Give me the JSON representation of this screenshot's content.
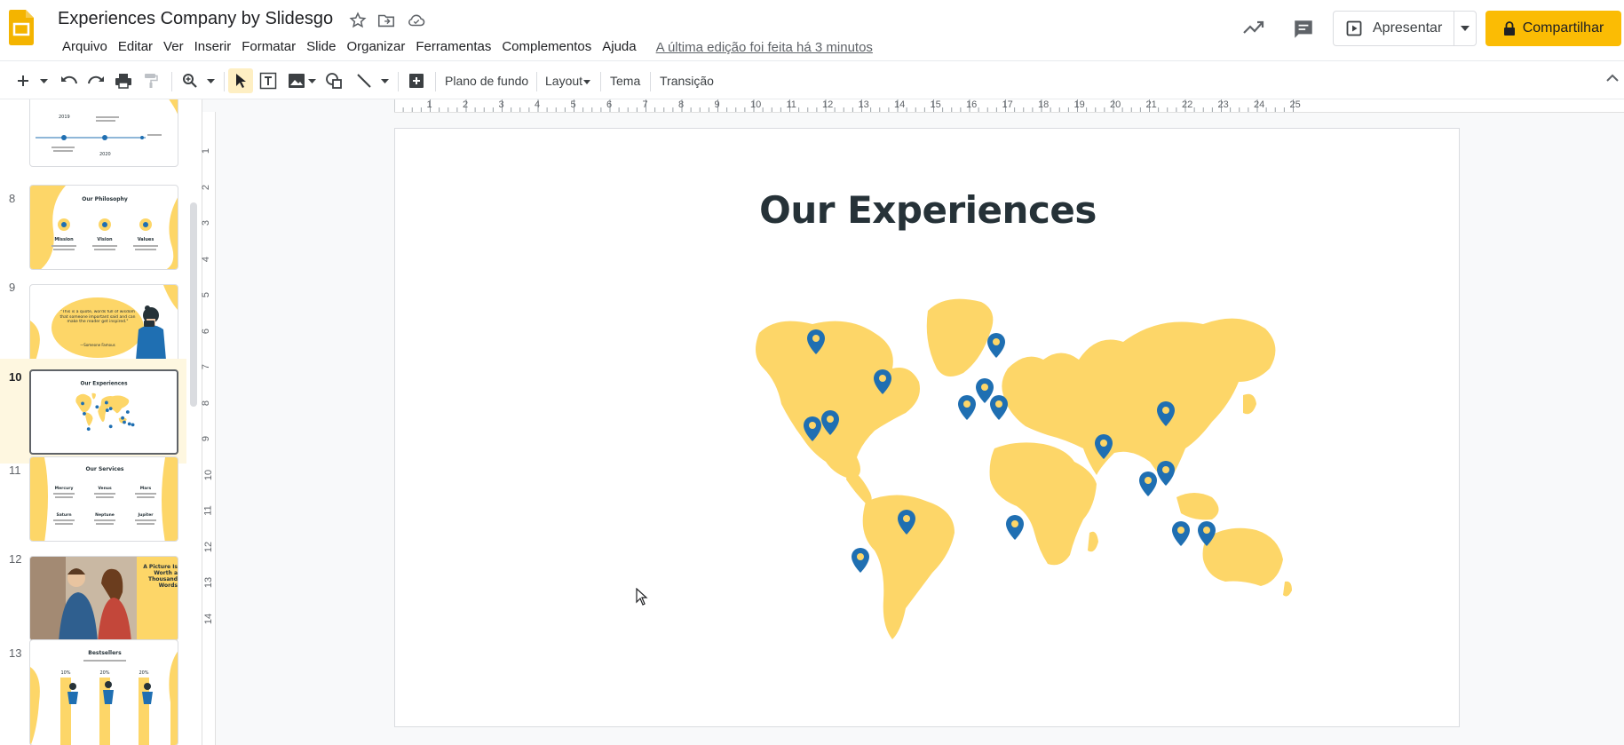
{
  "app": {
    "document_title": "Experiences Company by Slidesgo",
    "menu": [
      "Arquivo",
      "Editar",
      "Ver",
      "Inserir",
      "Formatar",
      "Slide",
      "Organizar",
      "Ferramentas",
      "Complementos",
      "Ajuda"
    ],
    "last_edit": "A última edição foi feita há 3 minutos",
    "present_label": "Apresentar",
    "share_label": "Compartilhar",
    "accent_color": "#fbbc04"
  },
  "toolbar": {
    "background_label": "Plano de fundo",
    "layout_label": "Layout",
    "theme_label": "Tema",
    "transition_label": "Transição"
  },
  "filmstrip": {
    "slides": [
      {
        "number": "8",
        "title": "Our Philosophy",
        "labels": [
          "Mission",
          "Vision",
          "Values"
        ]
      },
      {
        "number": "9",
        "title": "",
        "quote": "\"This is a quote, words full of wisdom that someone important said and can make the reader get inspired.\"",
        "author": "—Someone Famous"
      },
      {
        "number": "10",
        "title": "Our Experiences",
        "selected": true
      },
      {
        "number": "11",
        "title": "Our Services",
        "labels": [
          "Mercury",
          "Venus",
          "Mars",
          "Saturn",
          "Neptune",
          "Jupiter"
        ]
      },
      {
        "number": "12",
        "title": "A Picture Is Worth a Thousand Words"
      },
      {
        "number": "13",
        "title": "Bestsellers",
        "labels": [
          "10%",
          "20%",
          "20%"
        ]
      }
    ],
    "partial_top": {
      "labels": [
        "2019",
        "2020"
      ]
    }
  },
  "rulers": {
    "horizontal": [
      "1",
      "2",
      "3",
      "4",
      "5",
      "6",
      "7",
      "8",
      "9",
      "10",
      "11",
      "12",
      "13",
      "14",
      "15",
      "16",
      "17",
      "18",
      "19",
      "20",
      "21",
      "22",
      "23",
      "24",
      "25"
    ],
    "vertical": [
      "1",
      "2",
      "3",
      "4",
      "5",
      "6",
      "7",
      "8",
      "9",
      "10",
      "11",
      "12",
      "13",
      "14"
    ]
  },
  "slide": {
    "title": "Our Experiences",
    "map_color": "#fdd668",
    "pin_color": "#1f6fb2"
  }
}
